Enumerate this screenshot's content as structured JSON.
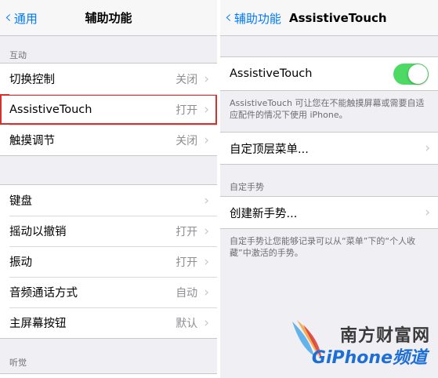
{
  "left": {
    "nav": {
      "back": "通用",
      "title": "辅助功能"
    },
    "section1": {
      "header": "互动",
      "rows": [
        {
          "label": "切换控制",
          "value": "关闭"
        },
        {
          "label": "AssistiveTouch",
          "value": "打开"
        },
        {
          "label": "触摸调节",
          "value": "关闭"
        }
      ]
    },
    "section2": {
      "rows": [
        {
          "label": "键盘",
          "value": ""
        },
        {
          "label": "摇动以撤销",
          "value": "打开"
        },
        {
          "label": "振动",
          "value": "打开"
        },
        {
          "label": "音频通话方式",
          "value": "自动"
        },
        {
          "label": "主屏幕按钮",
          "value": "默认"
        }
      ]
    },
    "section3": {
      "header": "听觉"
    }
  },
  "right": {
    "nav": {
      "back": "辅助功能",
      "title": "AssistiveTouch"
    },
    "toggle": {
      "label": "AssistiveTouch",
      "on": true,
      "color": "#4cd964"
    },
    "toggle_note": "AssistiveTouch 可让您在不能触摸屏幕或需要自适应配件的情况下使用 iPhone。",
    "customize": {
      "label": "自定顶层菜单..."
    },
    "gesture_section": {
      "header": "自定手势",
      "create": "创建新手势...",
      "note": "自定手势让您能够记录可以从“菜单”下的“个人收藏”中激活的手势。"
    }
  },
  "watermark": {
    "line1": "南方财富网",
    "line2": "GiPhone频道"
  },
  "colors": {
    "accent": "#007aff",
    "highlight": "#d8302a"
  }
}
